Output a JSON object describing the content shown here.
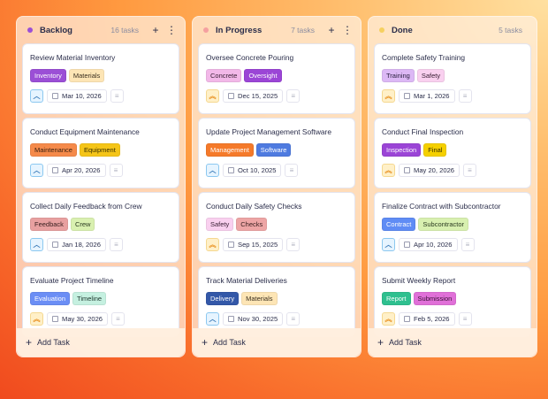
{
  "columns": [
    {
      "title": "Backlog",
      "count": "16 tasks",
      "dot": "#9b4fd6",
      "add_label": "Add Task",
      "cards": [
        {
          "title": "Review Material Inventory",
          "priority": "low",
          "date": "Mar 10, 2026",
          "tags": [
            {
              "label": "Inventory",
              "bg": "#9b4fd6",
              "fg": "#ffffff"
            },
            {
              "label": "Materials",
              "bg": "#fde5b5",
              "fg": "#3a3020"
            }
          ]
        },
        {
          "title": "Conduct Equipment Maintenance",
          "priority": "low",
          "date": "Apr 20, 2026",
          "tags": [
            {
              "label": "Maintenance",
              "bg": "#f58a4a",
              "fg": "#3a2010"
            },
            {
              "label": "Equipment",
              "bg": "#f5c518",
              "fg": "#3a3000"
            }
          ]
        },
        {
          "title": "Collect Daily Feedback from Crew",
          "priority": "low",
          "date": "Jan 18, 2026",
          "tags": [
            {
              "label": "Feedback",
              "bg": "#e8a0a0",
              "fg": "#3a2020"
            },
            {
              "label": "Crew",
              "bg": "#d9f0b0",
              "fg": "#2a3a20"
            }
          ]
        },
        {
          "title": "Evaluate Project Timeline",
          "priority": "high",
          "date": "May 30, 2026",
          "tags": [
            {
              "label": "Evaluation",
              "bg": "#6b8ef5",
              "fg": "#ffffff"
            },
            {
              "label": "Timeline",
              "bg": "#c5f0e0",
              "fg": "#203a30"
            }
          ]
        }
      ]
    },
    {
      "title": "In Progress",
      "count": "7 tasks",
      "dot": "#f5a0a0",
      "add_label": "Add Task",
      "cards": [
        {
          "title": "Oversee Concrete Pouring",
          "priority": "high",
          "date": "Dec 15, 2025",
          "tags": [
            {
              "label": "Concrete",
              "bg": "#f2b8e8",
              "fg": "#3a2035"
            },
            {
              "label": "Oversight",
              "bg": "#9b45d6",
              "fg": "#ffffff"
            }
          ]
        },
        {
          "title": "Update Project Management Software",
          "priority": "low",
          "date": "Oct 10, 2025",
          "tags": [
            {
              "label": "Management",
              "bg": "#f57a2a",
              "fg": "#ffffff"
            },
            {
              "label": "Software",
              "bg": "#4f7be0",
              "fg": "#ffffff"
            }
          ]
        },
        {
          "title": "Conduct Daily Safety Checks",
          "priority": "high",
          "date": "Sep 15, 2025",
          "tags": [
            {
              "label": "Safety",
              "bg": "#f9d0ef",
              "fg": "#3a2035"
            },
            {
              "label": "Checks",
              "bg": "#eda5a5",
              "fg": "#3a2020"
            }
          ]
        },
        {
          "title": "Track Material Deliveries",
          "priority": "low",
          "date": "Nov 30, 2025",
          "tags": [
            {
              "label": "Delivery",
              "bg": "#3358a8",
              "fg": "#ffffff"
            },
            {
              "label": "Materials",
              "bg": "#fde5b5",
              "fg": "#3a3020"
            }
          ]
        }
      ]
    },
    {
      "title": "Done",
      "count": "5 tasks",
      "dot": "#f5d060",
      "add_label": "Add Task",
      "cards": [
        {
          "title": "Complete Safety Training",
          "priority": "high",
          "date": "Mar 1, 2026",
          "tags": [
            {
              "label": "Training",
              "bg": "#dcb8f5",
              "fg": "#2a2040"
            },
            {
              "label": "Safety",
              "bg": "#f9d0ef",
              "fg": "#3a2035"
            }
          ]
        },
        {
          "title": "Conduct Final Inspection",
          "priority": "high",
          "date": "May 20, 2026",
          "tags": [
            {
              "label": "Inspection",
              "bg": "#9b45d6",
              "fg": "#ffffff"
            },
            {
              "label": "Final",
              "bg": "#f5d000",
              "fg": "#3a3000"
            }
          ]
        },
        {
          "title": "Finalize Contract with Subcontractor",
          "priority": "low",
          "date": "Apr 10, 2026",
          "tags": [
            {
              "label": "Contract",
              "bg": "#5f8cf5",
              "fg": "#ffffff"
            },
            {
              "label": "Subcontractor",
              "bg": "#d8f0b0",
              "fg": "#2a3a20"
            }
          ]
        },
        {
          "title": "Submit Weekly Report",
          "priority": "high",
          "date": "Feb 5, 2026",
          "tags": [
            {
              "label": "Report",
              "bg": "#2fc08f",
              "fg": "#ffffff"
            },
            {
              "label": "Submission",
              "bg": "#e070d8",
              "fg": "#3a1035"
            }
          ]
        }
      ]
    }
  ]
}
